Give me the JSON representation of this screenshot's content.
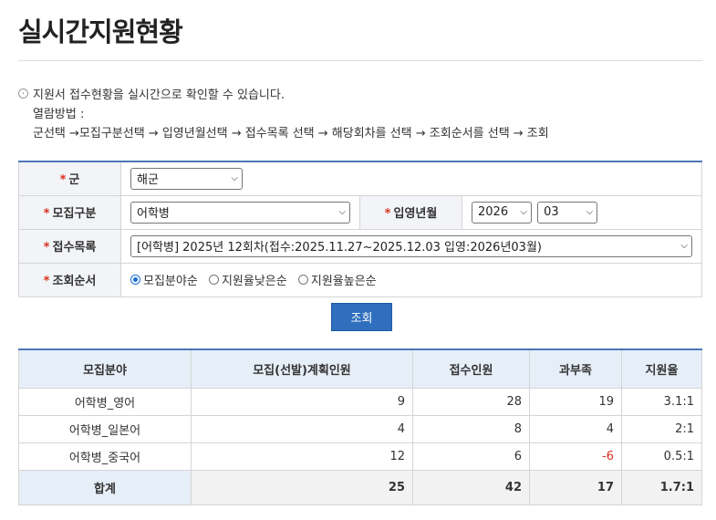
{
  "page_title": "실시간지원현황",
  "info": {
    "line1": "지원서 접수현황을 실시간으로 확인할 수 있습니다.",
    "line2": "열람방법 :",
    "line3": "군선택 →모집구분선택 → 입영년월선택 → 접수목록 선택 → 해당회차를 선택 → 조회순서를 선택 → 조회"
  },
  "form": {
    "required_mark": "*",
    "branch_label": "군",
    "branch_value": "해군",
    "category_label": "모집구분",
    "category_value": "어학병",
    "enlist_label": "입영년월",
    "year_value": "2026",
    "month_value": "03",
    "list_label": "접수목록",
    "list_value": "[어학병] 2025년 12회차(접수:2025.11.27~2025.12.03 입영:2026년03월)",
    "order_label": "조회순서",
    "order_options": [
      "모집분야순",
      "지원율낮은순",
      "지원율높은순"
    ],
    "order_selected": "모집분야순"
  },
  "search_button": "조회",
  "results": {
    "headers": [
      "모집분야",
      "모집(선발)계획인원",
      "접수인원",
      "과부족",
      "지원율"
    ],
    "rows": [
      {
        "field": "어학병_영어",
        "plan": "9",
        "applied": "28",
        "diff": "19",
        "rate": "3.1:1"
      },
      {
        "field": "어학병_일본어",
        "plan": "4",
        "applied": "8",
        "diff": "4",
        "rate": "2:1"
      },
      {
        "field": "어학병_중국어",
        "plan": "12",
        "applied": "6",
        "diff": "-6",
        "rate": "0.5:1"
      }
    ],
    "total": {
      "field": "합계",
      "plan": "25",
      "applied": "42",
      "diff": "17",
      "rate": "1.7:1"
    }
  },
  "colors": {
    "accent": "#2f6fbd",
    "negative": "#d9301f",
    "header_bg": "#e6eef8"
  }
}
